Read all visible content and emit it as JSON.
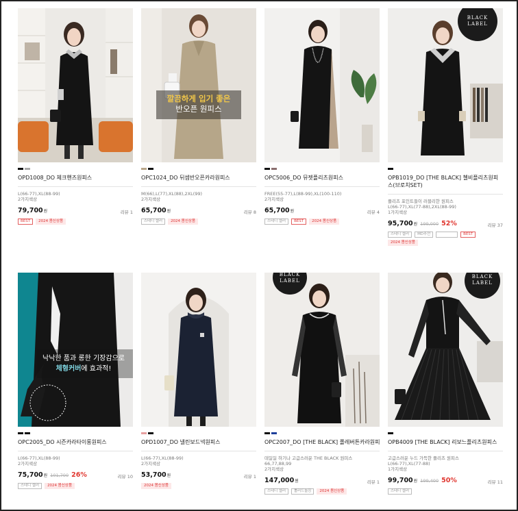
{
  "products": [
    {
      "name": "OPD1008_DO 체크핸즈원피스",
      "sizes": "L(66-77),XL(88-99)",
      "colors": "2가지색상",
      "price": "79,700",
      "won": "원",
      "review": "리뷰 1",
      "badges": [
        "BEST",
        "2024 봄신상품"
      ],
      "swatches": [
        "#111111",
        "#a9a9a9"
      ]
    },
    {
      "name": "OPC1024_DO 뒤셈반오픈카라원피스",
      "sizes": "M(66),L(77),XL(88),2XL(99)",
      "colors": "2가지색상",
      "price": "65,700",
      "won": "원",
      "review": "리뷰 8",
      "badges": [
        "스테디 셀러",
        "2024 봄신상품"
      ],
      "swatches": [
        "#b9a68a",
        "#111111"
      ],
      "caption_line1": "깔끔하게 입기 좋은",
      "caption_line2": "반오픈 원피스"
    },
    {
      "name": "OPC5006_DO 뮤젯플리츠원피스",
      "sizes": "FREE(55-77),L(88-99),XL(100-110)",
      "colors": "2가지색상",
      "price": "65,700",
      "won": "원",
      "review": "리뷰 4",
      "badges": [
        "스테디 셀러",
        "BEST",
        "2024 봄신상품"
      ],
      "swatches": [
        "#111111",
        "#8a6e6e"
      ]
    },
    {
      "name": "OPB1019_DO [THE BLACK] 첼비플리츠원피스(브로치SET)",
      "desc": "플리츠 포인트들이 러블리한 원피스",
      "sizes": "L(66-77),XL(77-88),2XL(88-99)",
      "colors": "1가지색상",
      "price": "95,700",
      "won": "원",
      "orig": "199,000",
      "discount": "52%",
      "review": "리뷰 37",
      "badges": [
        "스테디 셀러",
        "MD추천",
        "",
        "BEST",
        "2024 봄신상품"
      ],
      "swatches": [
        "#111111"
      ],
      "label_line1": "BLACK",
      "label_line2": "LABEL"
    },
    {
      "name": "OPC2005_DO 시즌카라타이롱원피스",
      "sizes": "L(66-77),XL(88-99)",
      "colors": "2가지색상",
      "price": "75,700",
      "won": "원",
      "orig": "101,700",
      "discount": "26%",
      "review": "리뷰 10",
      "badges": [
        "스테디 셀러",
        "2024 봄신상품"
      ],
      "swatches": [
        "#111111",
        "#111111"
      ],
      "caption_line1": "낙낙한 품과 롱한 기장감으로",
      "caption_line2a": "체형커버",
      "caption_line2b": "에 효과적!"
    },
    {
      "name": "OPD1007_DO 넬린보드넥원피스",
      "sizes": "L(66-77),XL(88-99)",
      "colors": "2가지색상",
      "price": "53,700",
      "won": "원",
      "review": "리뷰 1",
      "badges": [
        "2024 봄신상품"
      ],
      "swatches": [
        "#e8a0a0",
        "#111111"
      ]
    },
    {
      "name": "OPC2007_DO [THE BLACK] 폴레버튼카라원피스",
      "desc": "데일일 하기나 고급스러운 THE BLACK 원피스",
      "sizes": "66,77,88,99",
      "colors": "2가지색상",
      "price": "147,000",
      "won": "원",
      "review": "리뷰 1",
      "badges": [
        "스테디 셀러",
        "톨러드놀칭",
        "2024 봄신상품"
      ],
      "swatches": [
        "#111111",
        "#1f3f9a"
      ],
      "label_line1": "BLACK",
      "label_line2": "LABEL"
    },
    {
      "name": "OPB4009 [THE BLACK] 리보느플리츠원피스",
      "desc": "고급스러운 누드 가득한 플리츠 원피스",
      "sizes": "L(66-77),XL(77-88)",
      "colors": "1가지색상",
      "price": "99,700",
      "won": "원",
      "orig": "199,400",
      "discount": "50%",
      "review": "리뷰 11",
      "badges": [
        "스테디 셀러"
      ],
      "swatches": [
        "#111111"
      ],
      "label_line1": "BLACK",
      "label_line2": "LABEL"
    }
  ]
}
